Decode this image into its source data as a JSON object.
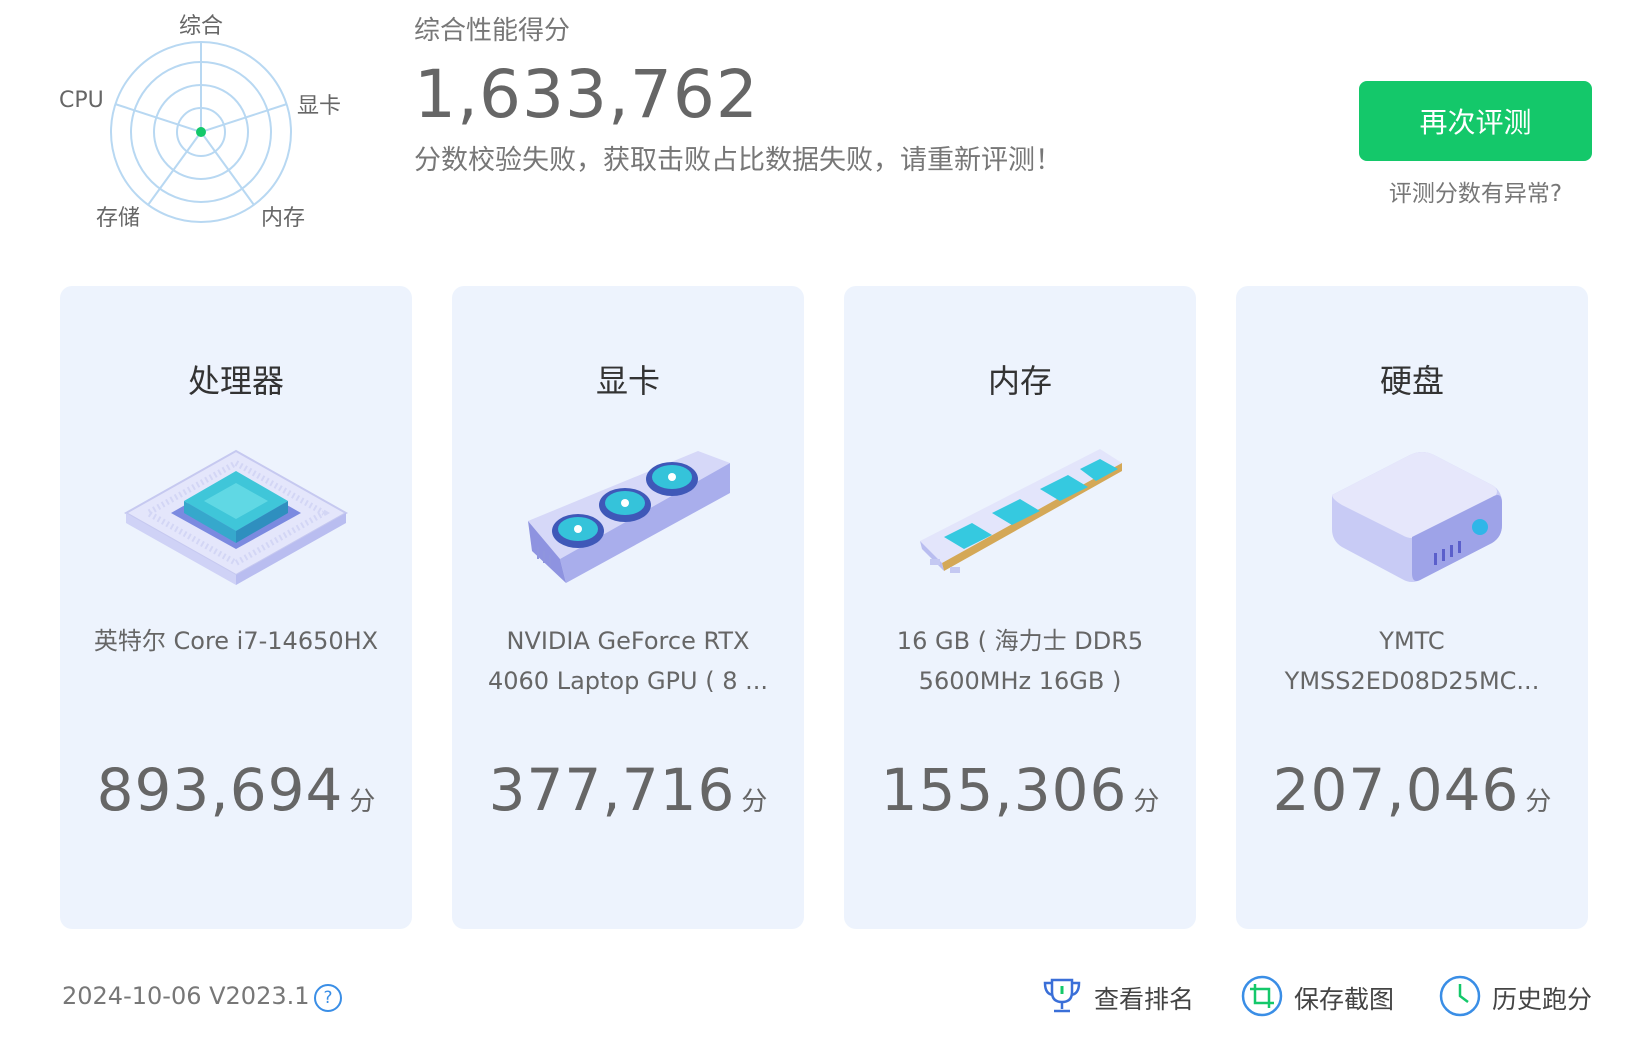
{
  "radar": {
    "labels": {
      "top": "综合",
      "left": "CPU",
      "right": "显卡",
      "bottom_left": "存储",
      "bottom_right": "内存"
    }
  },
  "summary": {
    "title": "综合性能得分",
    "score": "1,633,762",
    "message": "分数校验失败，获取击败占比数据失败，请重新评测！"
  },
  "actions": {
    "retest_label": "再次评测",
    "abnormal_label": "评测分数有异常?"
  },
  "cards": [
    {
      "title": "处理器",
      "desc": "英特尔 Core i7-14650HX",
      "score": "893,694",
      "unit": "分"
    },
    {
      "title": "显卡",
      "desc": "NVIDIA GeForce RTX 4060 Laptop GPU ( 8 ...",
      "score": "377,716",
      "unit": "分"
    },
    {
      "title": "内存",
      "desc": "16 GB ( 海力士 DDR5 5600MHz 16GB )",
      "score": "155,306",
      "unit": "分"
    },
    {
      "title": "硬盘",
      "desc": "YMTC YMSS2ED08D25MC...",
      "score": "207,046",
      "unit": "分"
    }
  ],
  "footer": {
    "version": "2024-10-06 V2023.1",
    "help": "?",
    "ranking": "查看排名",
    "screenshot": "保存截图",
    "history": "历史跑分"
  },
  "colors": {
    "accent": "#14c86a",
    "card_bg": "#edf3fd",
    "radar_line": "#b8d8f2",
    "icon_blue": "#3a8ee6"
  }
}
